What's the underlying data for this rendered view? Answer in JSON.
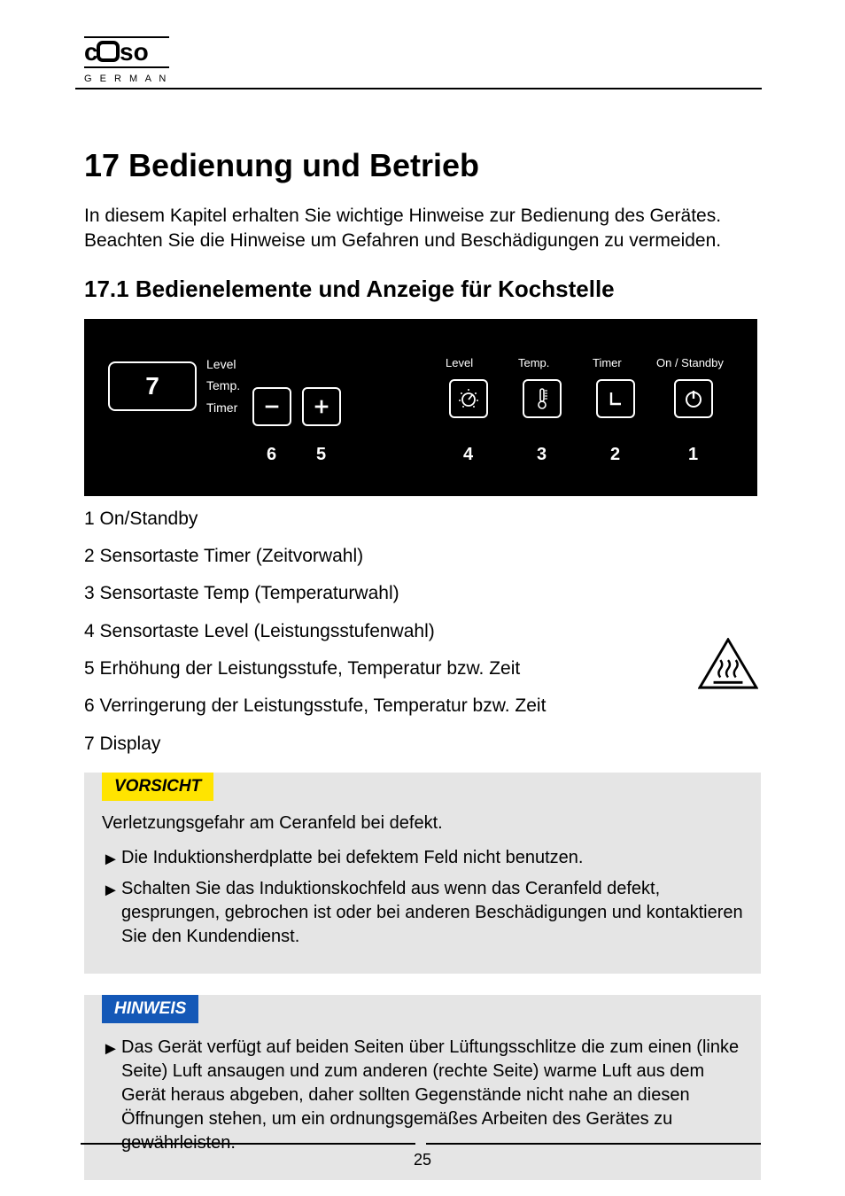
{
  "logo": {
    "brand": "caso",
    "subline": "G E R M A N Y"
  },
  "sec_title": "17  Bedienung und Betrieb",
  "intro": "In diesem Kapitel erhalten Sie wichtige Hinweise zur Bedienung des Gerätes. Beachten Sie die Hinweise um Gefahren und Beschädigungen zu vermeiden.",
  "sub_title": "17.1  Bedienelemente und Anzeige für Kochstelle",
  "panel": {
    "display_value": "7",
    "stack": {
      "level": "Level",
      "temp": "Temp.",
      "timer": "Timer"
    },
    "labels": {
      "level": "Level",
      "temp": "Temp.",
      "timer": "Timer",
      "onstb": "On / Standby"
    },
    "nums": {
      "n1": "1",
      "n2": "2",
      "n3": "3",
      "n4": "4",
      "n5": "5",
      "n6": "6"
    }
  },
  "legend": {
    "l1": "1 On/Standby",
    "l2": "2 Sensortaste Timer (Zeitvorwahl)",
    "l3": "3 Sensortaste Temp (Temperaturwahl)",
    "l4": "4 Sensortaste Level (Leistungsstufenwahl)",
    "l5": "5 Erhöhung der Leistungsstufe, Temperatur bzw. Zeit",
    "l6": "6 Verringerung der Leistungsstufe, Temperatur bzw. Zeit",
    "l7": "7 Display"
  },
  "warn_triangle_label": "hot-surface-warning",
  "vorsicht": {
    "tag": "VORSICHT",
    "lead": "Verletzungsgefahr am Ceranfeld bei defekt.",
    "b1": "Die Induktionsherdplatte bei defektem Feld nicht benutzen.",
    "b2": "Schalten Sie das Induktionskochfeld aus wenn das Ceranfeld defekt, gesprungen, gebrochen ist oder bei anderen Beschädigungen und kontaktieren Sie den Kundendienst."
  },
  "hinweis": {
    "tag": "HINWEIS",
    "b1": "Das Gerät verfügt auf beiden Seiten über Lüftungsschlitze die zum einen (linke Seite) Luft ansaugen und zum anderen (rechte Seite) warme Luft aus dem Gerät heraus abgeben, daher sollten Gegenstände nicht nahe an diesen Öffnungen stehen, um ein ordnungsgemäßes Arbeiten des Gerätes zu gewährleisten."
  },
  "page_number": "25"
}
